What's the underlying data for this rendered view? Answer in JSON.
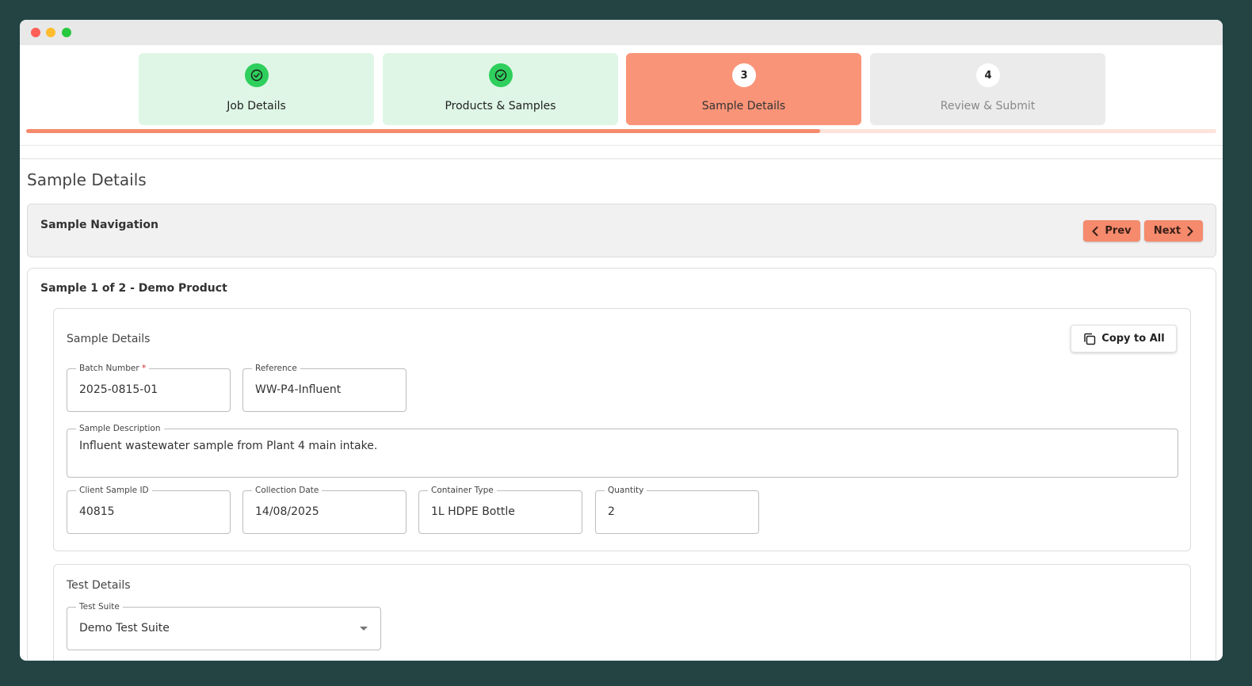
{
  "steps": [
    {
      "number": "",
      "label": "Job Details",
      "status": "done",
      "icon": "check-circle-icon"
    },
    {
      "number": "",
      "label": "Products & Samples",
      "status": "done",
      "icon": "check-circle-icon"
    },
    {
      "number": "3",
      "label": "Sample Details",
      "status": "active"
    },
    {
      "number": "4",
      "label": "Review & Submit",
      "status": "pending"
    }
  ],
  "progress_fraction": 0.667,
  "page_title": "Sample Details",
  "navigation": {
    "title": "Sample Navigation",
    "prev_label": "Prev",
    "next_label": "Next"
  },
  "sample": {
    "heading": "Sample 1 of 2 - Demo Product",
    "details_title": "Sample Details",
    "copy_label": "Copy to All",
    "fields": {
      "batch_number": {
        "label": "Batch Number",
        "required": "*",
        "value": "2025-0815-01"
      },
      "reference": {
        "label": "Reference",
        "value": "WW-P4-Influent"
      },
      "description": {
        "label": "Sample Description",
        "value": "Influent wastewater sample from Plant 4 main intake."
      },
      "client_sample_id": {
        "label": "Client Sample ID",
        "value": "40815"
      },
      "collection_date": {
        "label": "Collection Date",
        "value": "14/08/2025"
      },
      "container_type": {
        "label": "Container Type",
        "value": "1L HDPE Bottle"
      },
      "quantity": {
        "label": "Quantity",
        "value": "2"
      }
    },
    "tests_title": "Test Details",
    "test_suite": {
      "label": "Test Suite",
      "value": "Demo Test Suite"
    }
  },
  "colors": {
    "background": "#244444",
    "accent": "#f58a6c",
    "active_step": "#fa9478",
    "done_step": "#dff6e6",
    "success": "#2ecf5c"
  }
}
